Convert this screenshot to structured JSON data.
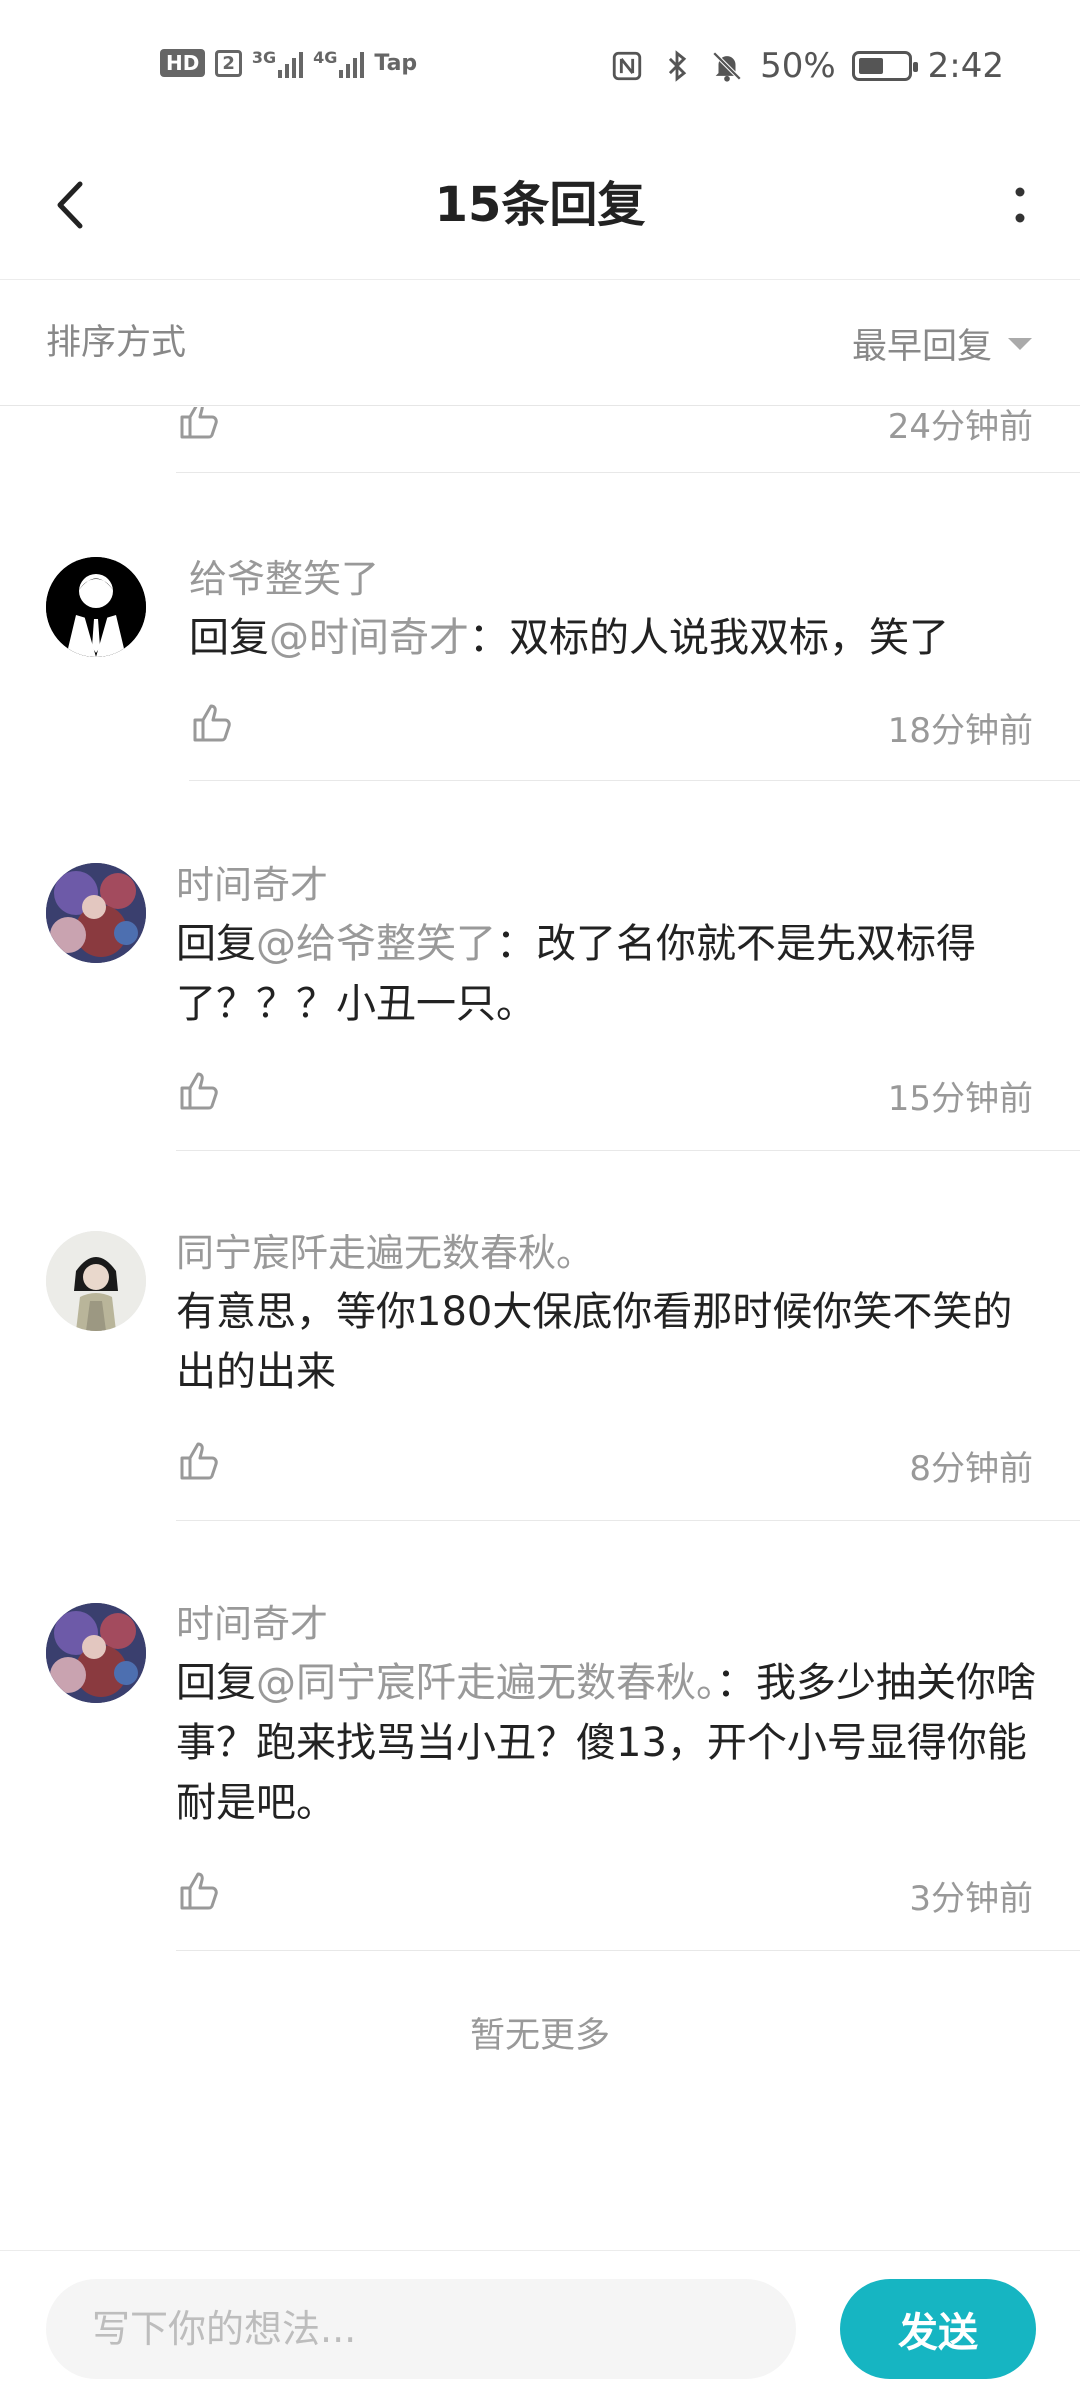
{
  "status_bar": {
    "hd": "HD",
    "hd_num": "2",
    "net1": "3G",
    "net2": "4G",
    "tap": "Tap",
    "battery": "50%",
    "time": "2:42"
  },
  "header": {
    "title": "15条回复"
  },
  "sort": {
    "label": "排序方式",
    "value": "最早回复"
  },
  "partial_item": {
    "time": "24分钟前"
  },
  "replies": [
    {
      "name": "给爷整笑了",
      "reply_prefix": "回复",
      "mention": "@时间奇才",
      "text": "：双标的人说我双标，笑了",
      "time": "18分钟前",
      "avatar": "suit-avatar"
    },
    {
      "name": "时间奇才",
      "reply_prefix": "回复",
      "mention": "@给爷整笑了",
      "text": "：改了名你就不是先双标得了？？？小丑一只。",
      "time": "15分钟前",
      "avatar": "game-art-avatar"
    },
    {
      "name": "同宁宸阡走遍无数春秋。",
      "reply_prefix": "",
      "mention": "",
      "text": "有意思，等你180大保底你看那时候你笑不笑的出的出来",
      "time": "8分钟前",
      "avatar": "girl-photo-avatar"
    },
    {
      "name": "时间奇才",
      "reply_prefix": "回复",
      "mention": "@同宁宸阡走遍无数春秋。",
      "text": "：我多少抽关你啥事？跑来找骂当小丑？傻13，开个小号显得你能耐是吧。",
      "time": "3分钟前",
      "avatar": "game-art-avatar"
    }
  ],
  "footer": {
    "no_more": "暂无更多"
  },
  "composer": {
    "placeholder": "写下你的想法...",
    "send": "发送"
  },
  "colors": {
    "accent": "#16b5c2",
    "muted_text": "#999999",
    "text": "#222222"
  }
}
